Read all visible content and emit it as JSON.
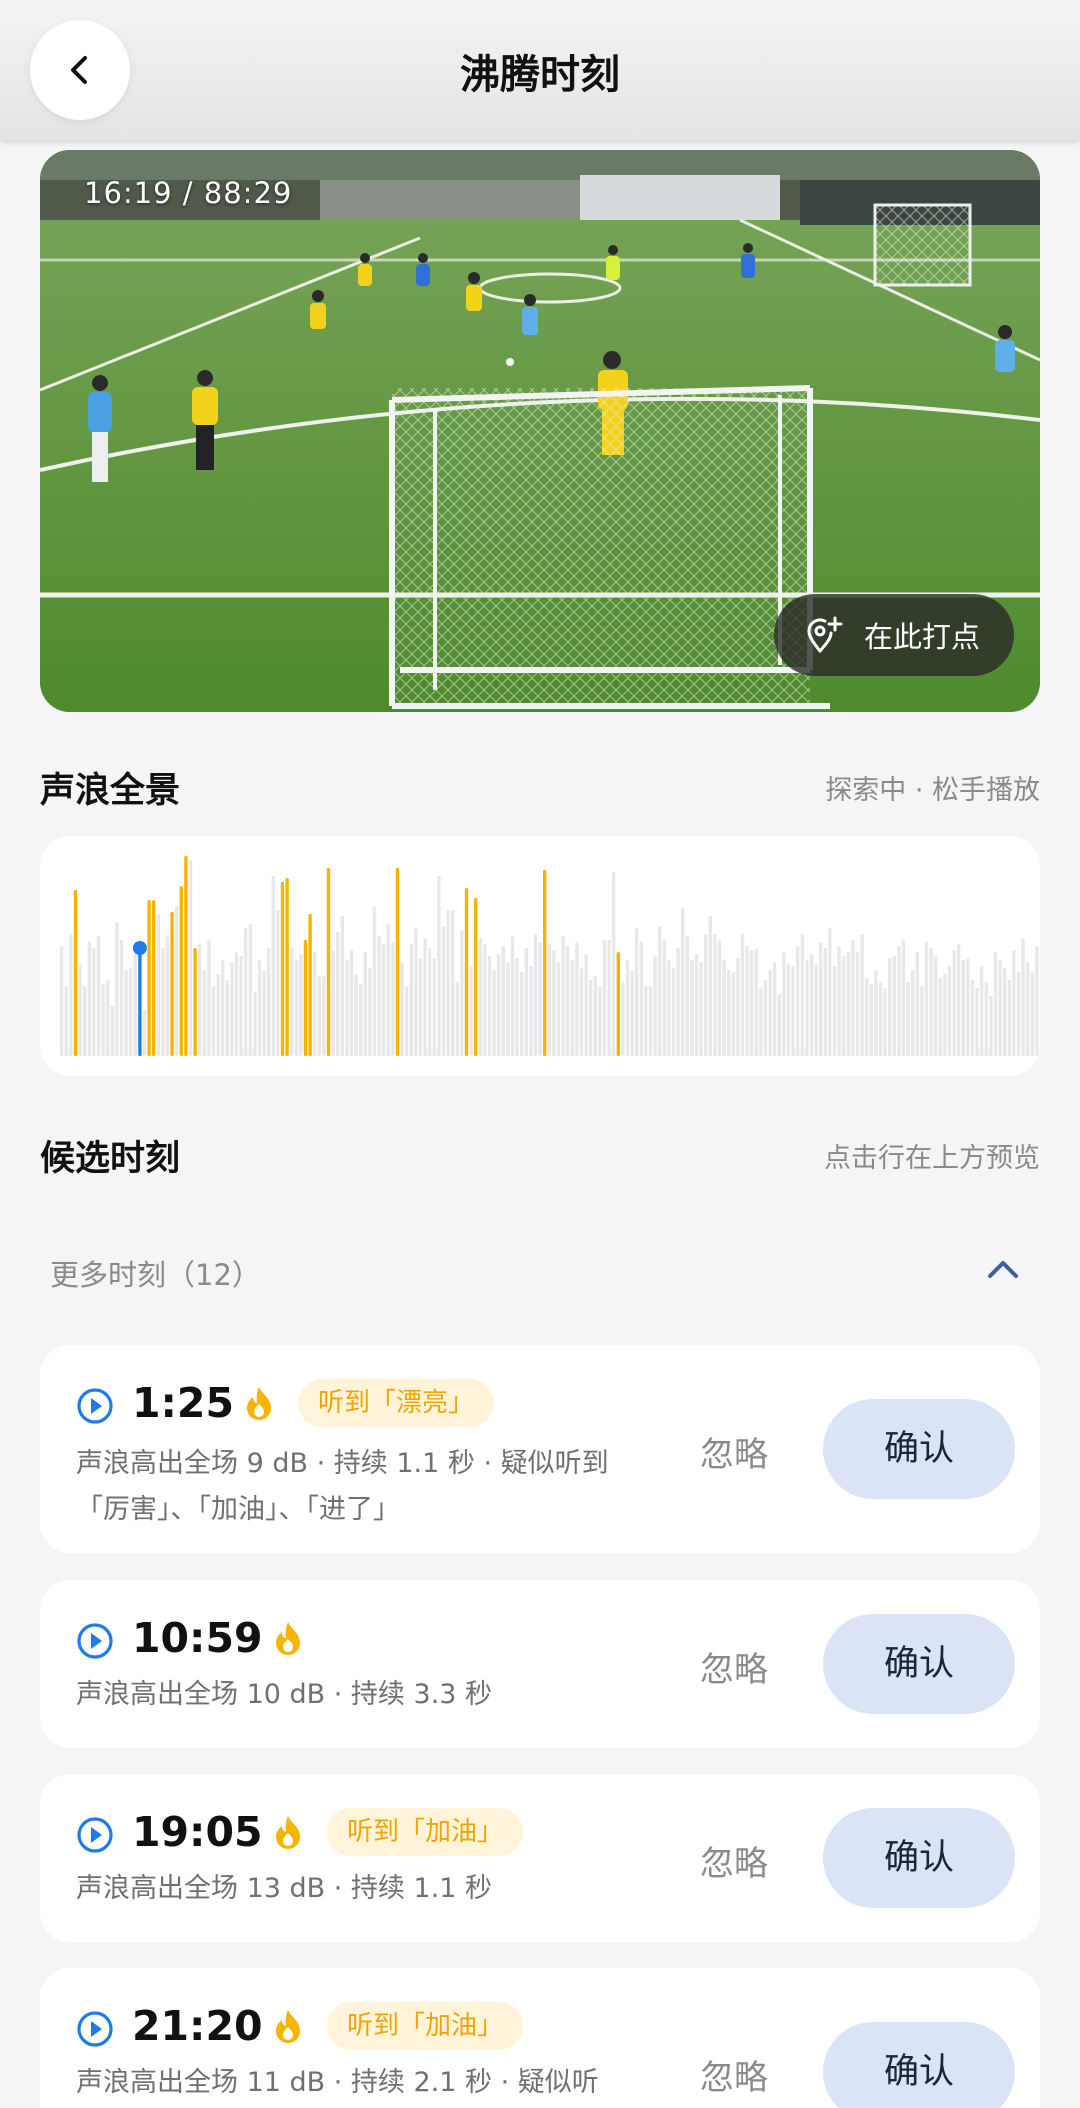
{
  "header": {
    "title": "沸腾时刻"
  },
  "video": {
    "timecode": "16:19 / 88:29",
    "mark_label": "在此打点"
  },
  "wave_section": {
    "title": "声浪全景",
    "hint": "探索中 · 松手播放",
    "colors": {
      "base": "#e8e8e8",
      "highlight": "#f5b400",
      "cursor": "#1e7bea"
    },
    "cursor_index": 17,
    "bars": [
      0.55,
      0.35,
      0.61,
      0.83,
      0.46,
      0.35,
      0.57,
      0.54,
      0.6,
      0.36,
      0.38,
      0.25,
      0.67,
      0.58,
      0.43,
      0.44,
      0.54,
      0.54,
      0.23,
      0.78,
      0.78,
      0.71,
      0.54,
      0.6,
      0.72,
      0.75,
      0.85,
      1.0,
      0.98,
      0.54,
      0.56,
      0.43,
      0.58,
      0.35,
      0.41,
      0.48,
      0.38,
      0.47,
      0.52,
      0.5,
      0.64,
      0.66,
      0.32,
      0.48,
      0.43,
      0.54,
      0.9,
      0.73,
      0.87,
      0.89,
      0.54,
      0.48,
      0.51,
      0.58,
      0.71,
      0.52,
      0.4,
      0.4,
      0.94,
      0.53,
      0.62,
      0.7,
      0.48,
      0.53,
      0.41,
      0.36,
      0.52,
      0.44,
      0.75,
      0.6,
      0.56,
      0.66,
      0.57,
      0.94,
      0.47,
      0.35,
      0.56,
      0.64,
      0.49,
      0.59,
      0.54,
      0.49,
      0.9,
      0.65,
      0.73,
      0.73,
      0.37,
      0.63,
      0.84,
      0.45,
      0.79,
      0.59,
      0.56,
      0.5,
      0.43,
      0.51,
      0.55,
      0.47,
      0.6,
      0.49,
      0.42,
      0.54,
      0.45,
      0.61,
      0.57,
      0.93,
      0.56,
      0.53,
      0.47,
      0.6,
      0.55,
      0.48,
      0.57,
      0.44,
      0.51,
      0.38,
      0.4,
      0.35,
      0.58,
      0.58,
      0.92,
      0.52,
      0.37,
      0.48,
      0.43,
      0.64,
      0.57,
      0.35,
      0.35,
      0.5,
      0.65,
      0.58,
      0.48,
      0.44,
      0.54,
      0.74,
      0.6,
      0.48,
      0.51,
      0.47,
      0.61,
      0.7,
      0.61,
      0.58,
      0.48,
      0.43,
      0.42,
      0.49,
      0.61,
      0.55,
      0.53,
      0.54,
      0.34,
      0.38,
      0.43,
      0.47,
      0.31,
      0.52,
      0.46,
      0.45,
      0.55,
      0.61,
      0.48,
      0.51,
      0.46,
      0.57,
      0.54,
      0.64,
      0.45,
      0.55,
      0.5,
      0.52,
      0.58,
      0.52,
      0.61,
      0.39,
      0.36,
      0.43,
      0.37,
      0.34,
      0.49,
      0.5,
      0.55,
      0.58,
      0.37,
      0.43,
      0.52,
      0.35,
      0.57,
      0.54,
      0.5,
      0.39,
      0.41,
      0.45,
      0.53,
      0.56,
      0.48,
      0.49,
      0.38,
      0.34,
      0.45,
      0.37,
      0.3,
      0.52,
      0.48,
      0.44,
      0.38,
      0.53,
      0.42,
      0.59,
      0.47,
      0.42,
      0.55,
      0.35,
      0.33,
      0.43
    ],
    "highlight_indices": [
      3,
      19,
      20,
      24,
      26,
      27,
      29,
      48,
      49,
      53,
      54,
      58,
      73,
      88,
      90,
      105,
      121
    ]
  },
  "candidates": {
    "title": "候选时刻",
    "hint": "点击行在上方预览"
  },
  "more": {
    "label": "更多时刻（12）"
  },
  "moments": [
    {
      "time": "1:25",
      "tag": "听到「漂亮」",
      "desc": "声浪高出全场 9 dB · 持续 1.1 秒 · 疑似听到「厉害」、「加油」、「进了」",
      "ignore": "忽略",
      "confirm": "确认"
    },
    {
      "time": "10:59",
      "tag": "",
      "desc": "声浪高出全场 10 dB · 持续 3.3 秒",
      "ignore": "忽略",
      "confirm": "确认"
    },
    {
      "time": "19:05",
      "tag": "听到「加油」",
      "desc": "声浪高出全场 13 dB · 持续 1.1 秒",
      "ignore": "忽略",
      "confirm": "确认"
    },
    {
      "time": "21:20",
      "tag": "听到「加油」",
      "desc": "声浪高出全场 11 dB · 持续 2.1 秒 · 疑似听",
      "ignore": "忽略",
      "confirm": "确认"
    }
  ]
}
